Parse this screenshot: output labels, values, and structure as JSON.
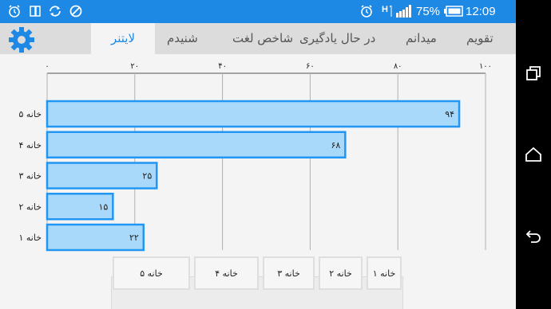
{
  "status_bar": {
    "time": "12:09 PM",
    "battery": "75%",
    "network": "H",
    "icons_left": [
      "alarm-icon",
      "sim-card-icon",
      "sync-icon",
      "sync-disabled-icon"
    ],
    "icons_right": [
      "alarm-clock-icon",
      "signal-icon",
      "battery-icon"
    ]
  },
  "tabs": [
    {
      "label": "تقویم",
      "active": false
    },
    {
      "label": "میدانم",
      "active": false
    },
    {
      "label": "در حال یادگیری",
      "active": false
    },
    {
      "label": "شاخص لغت",
      "active": false
    },
    {
      "label": "شنیدم",
      "active": false
    },
    {
      "label": "لایتنر",
      "active": true
    }
  ],
  "accent_color": "#1e88e5",
  "chart_data": {
    "type": "bar",
    "orientation": "horizontal",
    "categories": [
      "خانه ۵",
      "خانه ۴",
      "خانه ۳",
      "خانه ۲",
      "خانه ۱"
    ],
    "values": [
      94,
      68,
      25,
      15,
      22
    ],
    "value_labels": [
      "۹۴",
      "۶۸",
      "۲۵",
      "۱۵",
      "۲۲"
    ],
    "xlim": [
      0,
      100
    ],
    "xticks": [
      0,
      20,
      40,
      60,
      80,
      100
    ],
    "xtick_labels": [
      "۰",
      "۲۰",
      "۴۰",
      "۶۰",
      "۸۰",
      "۱۰۰"
    ],
    "axis_position": "top",
    "grid": true,
    "bar_fill": "#a8d8fa",
    "bar_stroke": "#2196f3"
  },
  "legend_boxes": [
    "خانه ۱",
    "خانه ۲",
    "خانه ۳",
    "خانه ۴",
    "خانه ۵"
  ],
  "nav_bar": {
    "buttons": [
      "recents-icon",
      "home-icon",
      "back-icon"
    ]
  }
}
